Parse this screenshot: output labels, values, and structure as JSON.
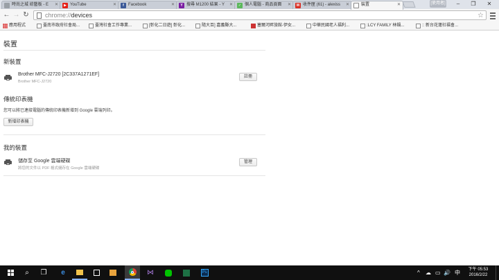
{
  "browser": {
    "tabs": [
      {
        "title": "時尚之城 綜藝板 - E",
        "favicon_color": "#9aa0a6",
        "favicon_glyph": ""
      },
      {
        "title": "YouTube",
        "favicon_color": "#e62117",
        "favicon_glyph": "▶"
      },
      {
        "title": "Facebook",
        "favicon_color": "#3b5998",
        "favicon_glyph": "f"
      },
      {
        "title": "搜尋 M1200 結果 - Y",
        "favicon_color": "#7b1fa2",
        "favicon_glyph": "Y"
      },
      {
        "title": "個人電腦 - 商品頁面",
        "favicon_color": "#5cb85c",
        "favicon_glyph": "✓"
      },
      {
        "title": "收件匣 (61) - alexiss",
        "favicon_color": "#d93025",
        "favicon_glyph": "M"
      },
      {
        "title": "裝置",
        "favicon_color": "#888888",
        "favicon_glyph": ""
      }
    ],
    "profile_label": "[使用者]",
    "window_controls": {
      "minimize": "–",
      "restore": "❐",
      "close": "✕"
    },
    "url_scheme": "chrome://",
    "url_host": "devices",
    "bookmarks": [
      {
        "label": "應用程式",
        "icon": "apps-icon"
      },
      {
        "label": "臺南市政府社會局...",
        "icon": "page-icon"
      },
      {
        "label": "臺灣社會工作專業...",
        "icon": "page-icon"
      },
      {
        "label": "[彰化二日遊] 彰化...",
        "icon": "page-icon"
      },
      {
        "label": "隨大百] 嘉義縣大...",
        "icon": "page-icon"
      },
      {
        "label": "塞爾河畔旅館-伊女...",
        "icon": "red-icon"
      },
      {
        "label": "中華民國老人福利...",
        "icon": "page-icon"
      },
      {
        "label": ":LCY FAMILY 林鍋...",
        "icon": "page-icon"
      },
      {
        "label": ":: 新台花蓮社福會...",
        "icon": "page-icon"
      }
    ]
  },
  "page": {
    "title": "裝置",
    "new_devices": {
      "heading": "新裝置",
      "device_name": "Brother MFC-J2720 [2C337A1271EF]",
      "device_model": "Brother MFC-J2720",
      "action": "註冊"
    },
    "classic_printers": {
      "heading": "傳統印表機",
      "description": "您可以將已連接電腦的傳統印表機新增到 Google 雲端列印。",
      "button": "新增印表機"
    },
    "my_devices": {
      "heading": "我的裝置",
      "device_name": "儲存至 Google 雲端硬碟",
      "device_desc": "將您的文件以 PDF 格式儲存在 Google 雲端硬碟",
      "action": "管理"
    }
  },
  "taskbar": {
    "start_icon": "windows-icon",
    "apps": [
      "search-icon",
      "task-view-icon",
      "edge-icon",
      "file-explorer-icon",
      "store-icon",
      "media-player-icon",
      "chrome-icon",
      "visual-studio-icon",
      "line-icon",
      "excel-icon",
      "photoshop-icon"
    ],
    "tray_glyphs": [
      "^",
      "☁",
      "▭",
      "🔊",
      "中"
    ],
    "time": "下午 05:53",
    "date": "2016/2/22"
  }
}
